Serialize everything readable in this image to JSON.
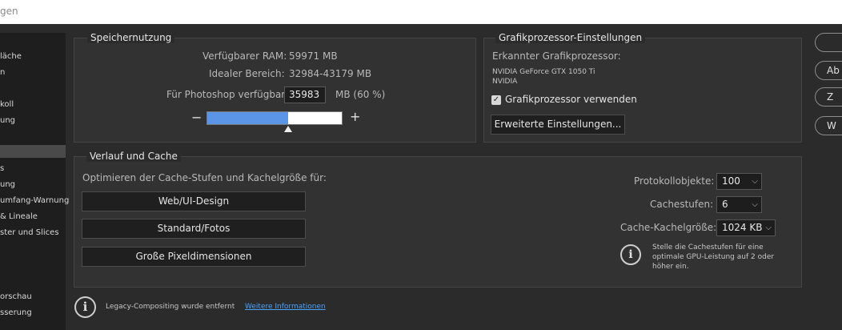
{
  "window": {
    "title_fragment": "gen"
  },
  "sidebar": {
    "items": [
      "läche",
      "n",
      "",
      "koll",
      "ung",
      "",
      "",
      "s",
      "ung",
      "umfang-Warnung",
      "& Lineale",
      "ster und Slices",
      "",
      "",
      "orschau",
      "sserung"
    ]
  },
  "memory": {
    "title": "Speichernutzung",
    "available_label": "Verfügbarer RAM:",
    "available_value": "59971 MB",
    "ideal_label": "Idealer Bereich:",
    "ideal_value": "32984-43179 MB",
    "photoshop_label": "Für Photoshop verfügbar:",
    "photoshop_input": "35983",
    "photoshop_unit": "MB (60 %)",
    "minus": "−",
    "plus": "+",
    "slider_fraction": 0.6
  },
  "gpu": {
    "title": "Grafikprozessor-Einstellungen",
    "detected_label": "Erkannter Grafikprozessor:",
    "gpu_name": "NVIDIA GeForce GTX 1050 Ti",
    "gpu_vendor": "NVIDIA",
    "use_gpu_label": "Grafikprozessor verwenden",
    "use_gpu_checked": true,
    "advanced_button": "Erweiterte Einstellungen..."
  },
  "cache": {
    "title": "Verlauf und Cache",
    "optimize_label": "Optimieren der Cache-Stufen und Kachelgröße für:",
    "btn_web": "Web/UI-Design",
    "btn_standard": "Standard/Fotos",
    "btn_large": "Große Pixeldimensionen",
    "history_label": "Protokollobjekte:",
    "history_value": "100",
    "levels_label": "Cachestufen:",
    "levels_value": "6",
    "tile_label": "Cache-Kachelgröße:",
    "tile_value": "1024 KB",
    "info_line1": "Stelle die Cachestufen für eine",
    "info_line2": "optimale GPU-Leistung auf 2 oder",
    "info_line3": "höher ein."
  },
  "legacy": {
    "text": "Legacy-Compositing wurde entfernt",
    "link": "Weitere Informationen"
  },
  "right_buttons": [
    "",
    "Ab",
    "Z",
    "W"
  ]
}
